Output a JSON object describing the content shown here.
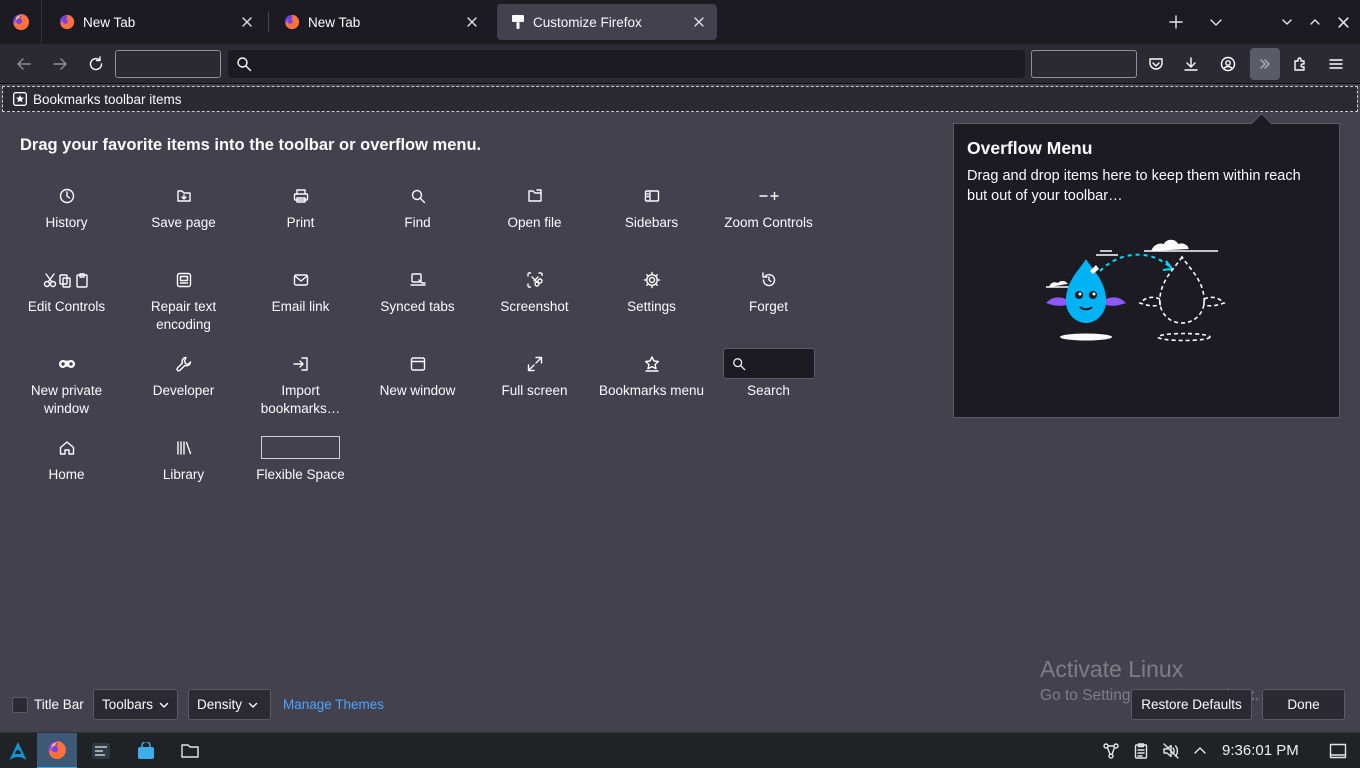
{
  "tabs": [
    {
      "title": "New Tab",
      "selected": false
    },
    {
      "title": "New Tab",
      "selected": false
    },
    {
      "title": "Customize Firefox",
      "selected": true
    }
  ],
  "navbar": {
    "url_value": ""
  },
  "bookmarks_toolbar": {
    "label": "Bookmarks toolbar items"
  },
  "palette": {
    "heading": "Drag your favorite items into the toolbar or overflow menu.",
    "items": [
      {
        "label": "History",
        "icon": "history-icon"
      },
      {
        "label": "Save page",
        "icon": "save-page-icon"
      },
      {
        "label": "Print",
        "icon": "print-icon"
      },
      {
        "label": "Find",
        "icon": "find-icon"
      },
      {
        "label": "Open file",
        "icon": "open-file-icon"
      },
      {
        "label": "Sidebars",
        "icon": "sidebars-icon"
      },
      {
        "label": "Zoom Controls",
        "icon": "zoom-controls-icon"
      },
      {
        "label": "Edit Controls",
        "icon": "edit-controls-icon"
      },
      {
        "label": "Repair text encoding",
        "icon": "repair-encoding-icon"
      },
      {
        "label": "Email link",
        "icon": "email-icon"
      },
      {
        "label": "Synced tabs",
        "icon": "synced-tabs-icon"
      },
      {
        "label": "Screenshot",
        "icon": "screenshot-icon"
      },
      {
        "label": "Settings",
        "icon": "gear-icon"
      },
      {
        "label": "Forget",
        "icon": "forget-icon"
      },
      {
        "label": "New private window",
        "icon": "private-window-icon"
      },
      {
        "label": "Developer",
        "icon": "wrench-icon"
      },
      {
        "label": "Import bookmarks…",
        "icon": "import-icon"
      },
      {
        "label": "New window",
        "icon": "new-window-icon"
      },
      {
        "label": "Full screen",
        "icon": "fullscreen-icon"
      },
      {
        "label": "Bookmarks menu",
        "icon": "bookmarks-menu-icon"
      },
      {
        "label": "Search",
        "icon": "search-icon"
      },
      {
        "label": "Home",
        "icon": "home-icon"
      },
      {
        "label": "Library",
        "icon": "library-icon"
      },
      {
        "label": "Flexible Space",
        "icon": "flexible-space-icon"
      }
    ]
  },
  "overflow_menu": {
    "title": "Overflow Menu",
    "description": "Drag and drop items here to keep them within reach but out of your toolbar…"
  },
  "footer": {
    "title_bar_label": "Title Bar",
    "title_bar_checked": false,
    "toolbars_label": "Toolbars",
    "density_label": "Density",
    "manage_themes_label": "Manage Themes",
    "restore_defaults_label": "Restore Defaults",
    "done_label": "Done"
  },
  "watermark": {
    "title": "Activate Linux",
    "subtitle": "Go to Settings to activate Linux."
  },
  "taskbar": {
    "clock": "9:36:01 PM"
  },
  "colors": {
    "accent_link": "#4ea5ff",
    "panel_bg": "#1c1b22",
    "content_bg": "#42414d",
    "taskbar_active": "#3daee9"
  }
}
